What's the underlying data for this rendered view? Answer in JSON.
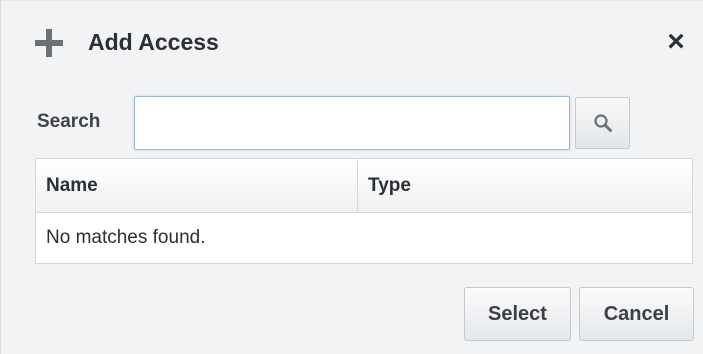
{
  "dialog": {
    "title": "Add Access",
    "close_glyph": "✕"
  },
  "search": {
    "label": "Search",
    "value": "",
    "placeholder": "",
    "button_icon": "search-icon"
  },
  "table": {
    "columns": [
      "Name",
      "Type"
    ],
    "rows": [],
    "empty_message": "No matches found."
  },
  "footer": {
    "select_label": "Select",
    "cancel_label": "Cancel"
  },
  "colors": {
    "background": "#f2f3f4",
    "input_focus_border": "#9cb9d8",
    "text": "#2c2f33",
    "icon": "#6b7075"
  }
}
